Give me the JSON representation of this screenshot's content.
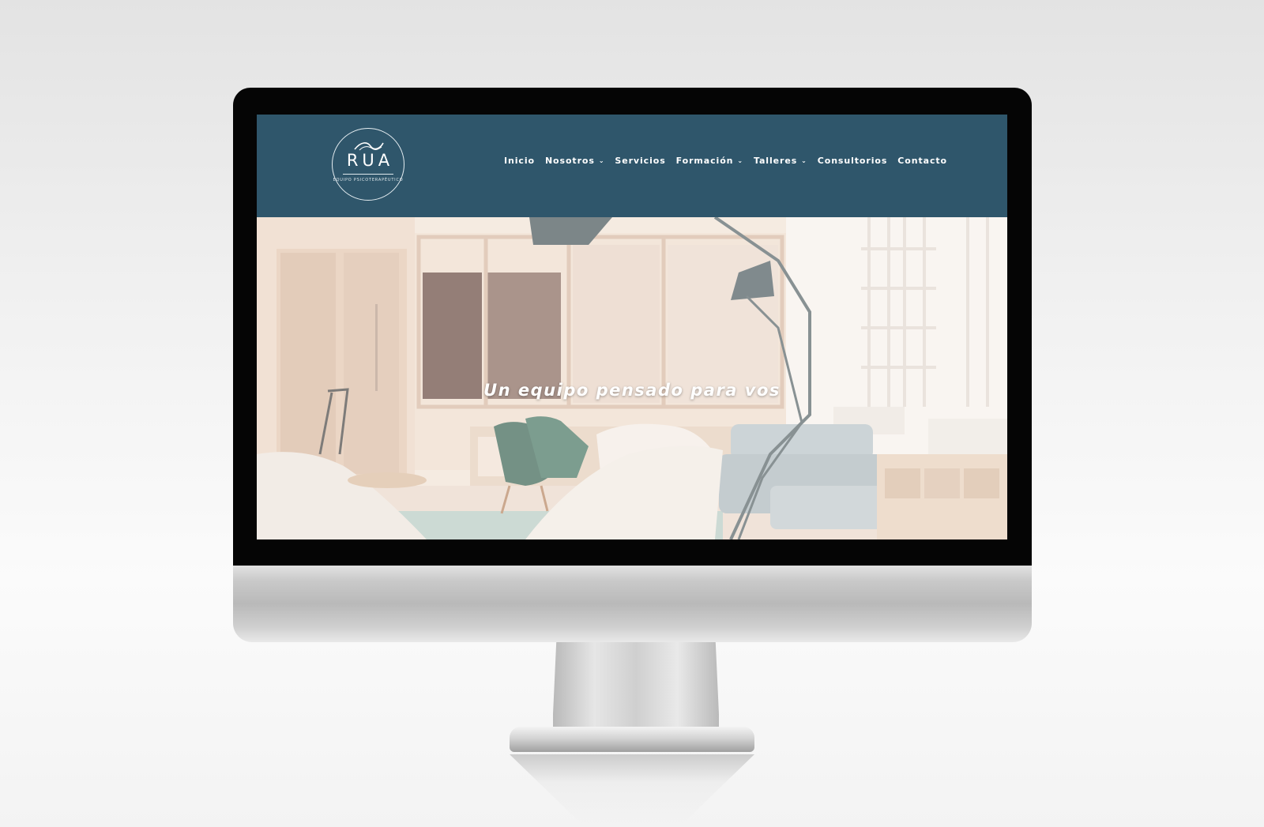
{
  "logo": {
    "name": "RUA",
    "subtitle": "EQUIPO PSICOTERAPÉUTICO"
  },
  "nav": {
    "items": [
      {
        "label": "Inicio",
        "dropdown": false
      },
      {
        "label": "Nosotros",
        "dropdown": true
      },
      {
        "label": "Servicios",
        "dropdown": false
      },
      {
        "label": "Formación",
        "dropdown": true
      },
      {
        "label": "Talleres",
        "dropdown": true
      },
      {
        "label": "Consultorios",
        "dropdown": false
      },
      {
        "label": "Contacto",
        "dropdown": false
      }
    ],
    "chevron_icon": "chevron-down-icon"
  },
  "hero": {
    "title": "Un equipo pensado para vos"
  },
  "colors": {
    "header_bg": "#2f566b",
    "nav_text": "#ffffff",
    "bezel": "#050505"
  }
}
